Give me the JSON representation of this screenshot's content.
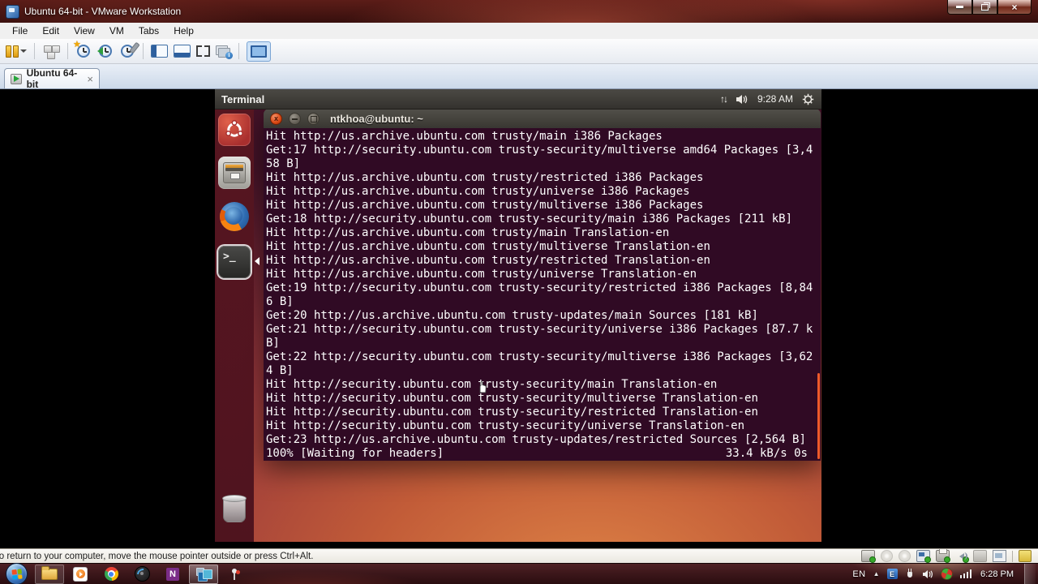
{
  "window": {
    "title": "Ubuntu 64-bit - VMware Workstation",
    "menu": [
      "File",
      "Edit",
      "View",
      "VM",
      "Tabs",
      "Help"
    ],
    "tab_label": "Ubuntu 64-bit",
    "status_message": "To return to your computer, move the mouse pointer outside or press Ctrl+Alt."
  },
  "ubuntu": {
    "panel": {
      "app": "Terminal",
      "time": "9:28 AM"
    },
    "launcher": [
      "dash",
      "files",
      "firefox",
      "terminal",
      "trash"
    ],
    "terminal": {
      "title": "ntkhoa@ubuntu: ~",
      "lines": [
        "Hit http://us.archive.ubuntu.com trusty/main i386 Packages",
        "Get:17 http://security.ubuntu.com trusty-security/multiverse amd64 Packages [3,4",
        "58 B]",
        "Hit http://us.archive.ubuntu.com trusty/restricted i386 Packages",
        "Hit http://us.archive.ubuntu.com trusty/universe i386 Packages",
        "Hit http://us.archive.ubuntu.com trusty/multiverse i386 Packages",
        "Get:18 http://security.ubuntu.com trusty-security/main i386 Packages [211 kB]",
        "Hit http://us.archive.ubuntu.com trusty/main Translation-en",
        "Hit http://us.archive.ubuntu.com trusty/multiverse Translation-en",
        "Hit http://us.archive.ubuntu.com trusty/restricted Translation-en",
        "Hit http://us.archive.ubuntu.com trusty/universe Translation-en",
        "Get:19 http://security.ubuntu.com trusty-security/restricted i386 Packages [8,84",
        "6 B]",
        "Get:20 http://us.archive.ubuntu.com trusty-updates/main Sources [181 kB]",
        "Get:21 http://security.ubuntu.com trusty-security/universe i386 Packages [87.7 k",
        "B]",
        "Get:22 http://security.ubuntu.com trusty-security/multiverse i386 Packages [3,62",
        "4 B]",
        "Hit http://security.ubuntu.com trusty-security/main Translation-en",
        "Hit http://security.ubuntu.com trusty-security/multiverse Translation-en",
        "Hit http://security.ubuntu.com trusty-security/restricted Translation-en",
        "Hit http://security.ubuntu.com trusty-security/universe Translation-en",
        "Get:23 http://us.archive.ubuntu.com trusty-updates/restricted Sources [2,564 B]"
      ],
      "progress_left": "100% [Waiting for headers]",
      "progress_right": "33.4 kB/s 0s"
    }
  },
  "taskbar": {
    "language": "EN",
    "time": "6:28 PM"
  },
  "icons": {
    "close": "×",
    "tab_close": "×",
    "terminal_close": "x",
    "tray_expand": "▲",
    "network_up_down": "↑↓",
    "snapshot_star": "★",
    "info_i": "i",
    "onenote_n": "N",
    "tray_e": "E",
    "terminal_prompt": ">_"
  },
  "colors": {
    "ubuntu_orange": "#dd4814",
    "terminal_bg": "#300a24",
    "panel_bg": "#3c3b37",
    "wallpaper_top": "#451329",
    "wallpaper_bottom": "#dd8145",
    "scrollbar_orange": "#ef5a2a",
    "taskbar_bg": "#2a0d10",
    "titlebar_maroon": "#5c1d18"
  }
}
